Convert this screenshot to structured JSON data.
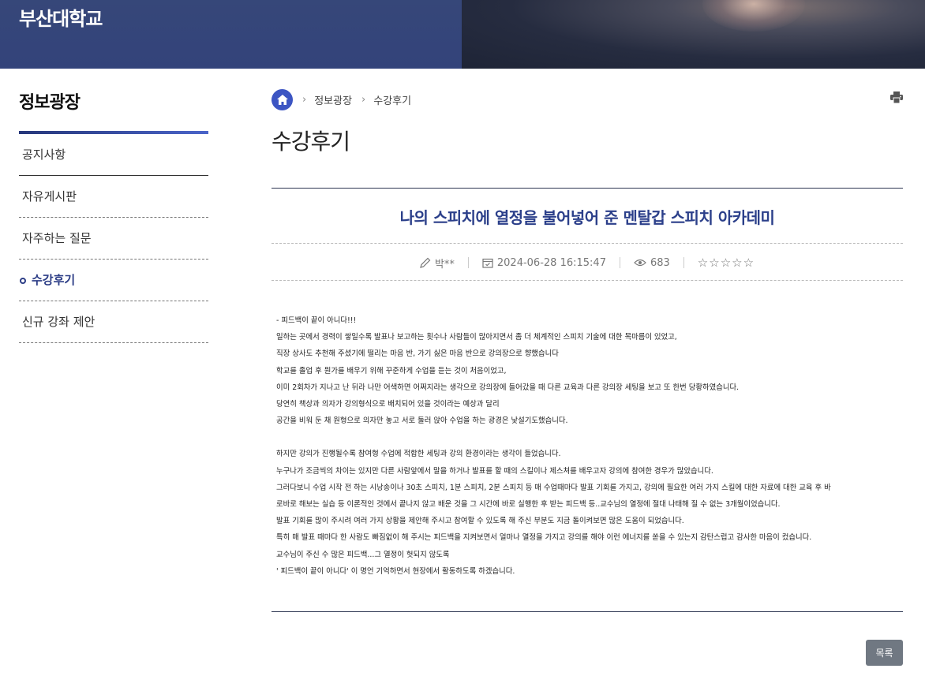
{
  "header": {
    "logo_text": "부산대학교"
  },
  "sidebar": {
    "title": "정보광장",
    "items": [
      {
        "label": "공지사항",
        "active": false
      },
      {
        "label": "자유게시판",
        "active": false
      },
      {
        "label": "자주하는 질문",
        "active": false
      },
      {
        "label": "수강후기",
        "active": true
      },
      {
        "label": "신규 강좌 제안",
        "active": false
      }
    ]
  },
  "breadcrumb": {
    "items": [
      "정보광장",
      "수강후기"
    ]
  },
  "page": {
    "title": "수강후기"
  },
  "post": {
    "title": "나의 스피치에 열정을 불어넣어 준 멘탈갑 스피치 아카데미",
    "author": "박**",
    "datetime": "2024-06-28 16:15:47",
    "views": "683",
    "rating": 0,
    "rating_max": 5,
    "body": [
      "- 피드백이 끝이 아니다!!!",
      "일하는 곳에서 경력이 쌓일수록 발표나 보고하는 횟수나 사람들이 많아지면서 좀 더 체계적인 스피치 기술에 대한 목마름이 있었고,",
      "직장 상사도 추천해 주셨기에 떨리는 마음 반, 가기 싫은 마음 반으로 강의장으로 향했습니다",
      "학교를 졸업 후 뭔가를 배우기 위해 꾸준하게 수업을 듣는 것이 처음이었고,",
      "이미 2회차가 지나고 난 뒤라 나만 어색하면 어쩌지라는 생각으로 강의장에 들어갔을 때 다른 교육과 다른 강의장 세팅을 보고 또 한번 당황하였습니다.",
      "당연히 책상과 의자가 강의형식으로 배치되어 있을 것이라는 예상과 달리",
      "공간을 비워 둔 채 원형으로 의자만 놓고 서로 둘러 앉아 수업을 하는 광경은 낯설기도했습니다.",
      "",
      "하지만 강의가 진행될수록 참여형 수업에 적합한 세팅과 강의 환경이라는 생각이 들었습니다.",
      "누구나가 조금씩의 차이는 있지만 다른 사람앞에서 말을 하거나 발표를 할 때의 스킬이나 제스쳐를 배우고자 강의에 참여한 경우가 많았습니다.",
      "그러다보니 수업 시작 전 하는 시낭송이나 30초 스피치, 1분 스피치, 2분 스피치 등 매 수업때마다 발표 기회를 가지고, 강의에 필요한 여러 가지 스킬에 대한 자료에 대한 교육 후 바",
      "로바로 해보는 실습 등 이론적인 것에서 끝나지 않고 배운 것을 그 시간에 바로 실행한 후 받는 피드백 등..교수님의 열정에 절대 나태해 질 수 없는 3개월이었습니다.",
      "발표 기회를 많이 주시려 여러 가지 상황을 제안해 주시고 참여할 수 있도록 해 주신 부분도 지금 돌이켜보면 많은 도움이 되었습니다.",
      "특히 매 발표 때마다 한 사람도 빠짐없이 해 주시는 피드백을 지켜보면서 얼마나 열정을 가지고 강의를 해야 이런 에너지를 쏟을 수 있는지 감탄스럽고 감사한 마음이 컸습니다.",
      "교수님이 주신 수 많은 피드백...그 열정이 헛되지 않도록",
      "' 피드백이 끝이 아니다' 이 명언 기억하면서 현장에서 활동하도록 하겠습니다."
    ]
  },
  "actions": {
    "list_button": "목록"
  },
  "colors": {
    "accent": "#2b3f8a",
    "header_bg": "#34447a",
    "home_icon": "#3c55c3"
  },
  "icons": [
    "home-icon",
    "chevron-right-icon",
    "print-icon",
    "pencil-icon",
    "calendar-icon",
    "eye-icon",
    "star-icon"
  ]
}
